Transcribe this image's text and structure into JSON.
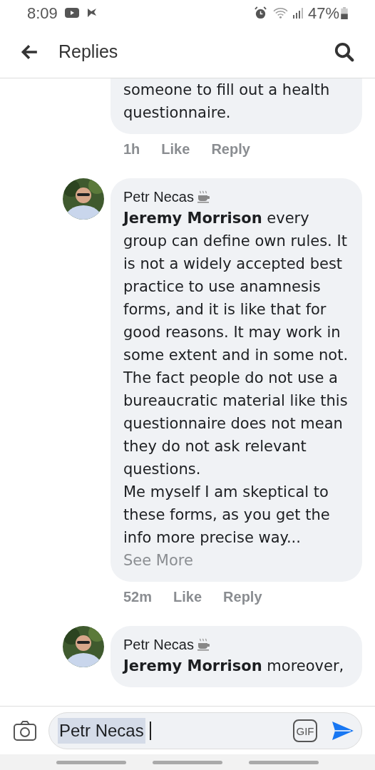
{
  "status_bar": {
    "time": "8:09",
    "battery": "47%"
  },
  "header": {
    "title": "Replies"
  },
  "comments": [
    {
      "cut_top": true,
      "paragraphs": [
        "someone to fill out a health questionnaire."
      ],
      "time": "1h",
      "actions": [
        "Like",
        "Reply"
      ]
    },
    {
      "author": "Petr Necas",
      "paragraphs": [
        "**Jeremy Morrison** every group can define own rules. It is not a widely accepted best practice to use anamnesis forms, and it is like that for good reasons. It may work in some extent and in some not.",
        "The fact people do not use a bureaucratic material like this questionnaire does not mean they do not ask relevant questions.",
        "Me myself I am skeptical to these forms, as you get the info more precise way..."
      ],
      "see_more": "See More",
      "time": "52m",
      "actions": [
        "Like",
        "Reply"
      ]
    },
    {
      "author": "Petr Necas",
      "paragraphs": [
        "**Jeremy Morrison** moreover,"
      ]
    }
  ],
  "composer": {
    "value": "Petr Necas",
    "gif": "GIF"
  }
}
